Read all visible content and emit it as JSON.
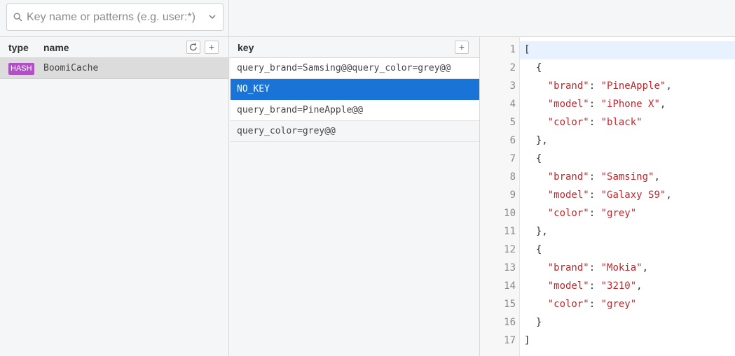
{
  "search": {
    "placeholder": "Key name or patterns (e.g. user:*)",
    "value": ""
  },
  "left_panel": {
    "col_type": "type",
    "col_name": "name",
    "rows": [
      {
        "type": "HASH",
        "name": "BoomiCache",
        "type_color": "#b04fc6"
      }
    ]
  },
  "middle_panel": {
    "col_key": "key",
    "add_label": "+",
    "rows": [
      {
        "key": "query_brand=Samsing@@query_color=grey@@"
      },
      {
        "key": "NO_KEY"
      },
      {
        "key": "query_brand=PineApple@@"
      },
      {
        "key": "query_color=grey@@"
      }
    ],
    "selected_index": 1
  },
  "left_add_label": "+",
  "editor": {
    "line_numbers": [
      "1",
      "2",
      "3",
      "4",
      "5",
      "6",
      "7",
      "8",
      "9",
      "10",
      "11",
      "12",
      "13",
      "14",
      "15",
      "16",
      "17"
    ],
    "lines": [
      {
        "pre": "[",
        "k": "",
        "mid": "",
        "v": "",
        "post": ""
      },
      {
        "pre": "  {",
        "k": "",
        "mid": "",
        "v": "",
        "post": ""
      },
      {
        "pre": "    ",
        "k": "\"brand\"",
        "mid": ": ",
        "v": "\"PineApple\"",
        "post": ","
      },
      {
        "pre": "    ",
        "k": "\"model\"",
        "mid": ": ",
        "v": "\"iPhone X\"",
        "post": ","
      },
      {
        "pre": "    ",
        "k": "\"color\"",
        "mid": ": ",
        "v": "\"black\"",
        "post": ""
      },
      {
        "pre": "  },",
        "k": "",
        "mid": "",
        "v": "",
        "post": ""
      },
      {
        "pre": "  {",
        "k": "",
        "mid": "",
        "v": "",
        "post": ""
      },
      {
        "pre": "    ",
        "k": "\"brand\"",
        "mid": ": ",
        "v": "\"Samsing\"",
        "post": ","
      },
      {
        "pre": "    ",
        "k": "\"model\"",
        "mid": ": ",
        "v": "\"Galaxy S9\"",
        "post": ","
      },
      {
        "pre": "    ",
        "k": "\"color\"",
        "mid": ": ",
        "v": "\"grey\"",
        "post": ""
      },
      {
        "pre": "  },",
        "k": "",
        "mid": "",
        "v": "",
        "post": ""
      },
      {
        "pre": "  {",
        "k": "",
        "mid": "",
        "v": "",
        "post": ""
      },
      {
        "pre": "    ",
        "k": "\"brand\"",
        "mid": ": ",
        "v": "\"Mokia\"",
        "post": ","
      },
      {
        "pre": "    ",
        "k": "\"model\"",
        "mid": ": ",
        "v": "\"3210\"",
        "post": ","
      },
      {
        "pre": "    ",
        "k": "\"color\"",
        "mid": ": ",
        "v": "\"grey\"",
        "post": ""
      },
      {
        "pre": "  }",
        "k": "",
        "mid": "",
        "v": "",
        "post": ""
      },
      {
        "pre": "]",
        "k": "",
        "mid": "",
        "v": "",
        "post": ""
      }
    ]
  },
  "colors": {
    "selected": "#1a73d6",
    "hash_badge": "#b04fc6",
    "string": "#c0272d"
  }
}
